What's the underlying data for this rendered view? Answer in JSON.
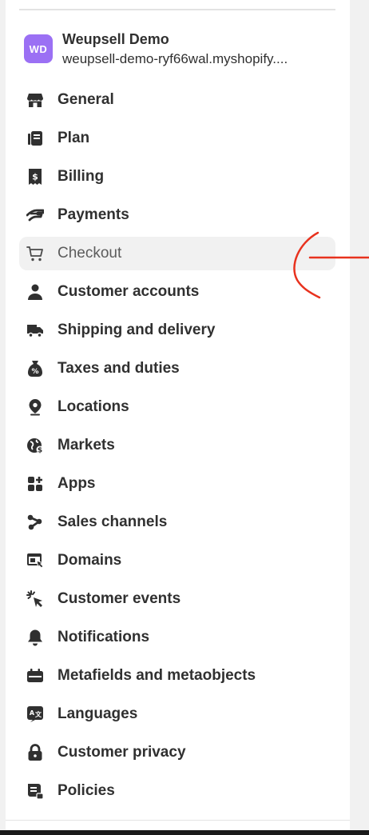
{
  "store": {
    "initials": "WD",
    "name": "Weupsell Demo",
    "domain": "weupsell-demo-ryf66wal.myshopify...."
  },
  "nav": {
    "items": [
      {
        "label": "General",
        "icon": "store-icon"
      },
      {
        "label": "Plan",
        "icon": "plan-icon"
      },
      {
        "label": "Billing",
        "icon": "billing-icon"
      },
      {
        "label": "Payments",
        "icon": "payments-icon"
      },
      {
        "label": "Checkout",
        "icon": "cart-icon",
        "selected": true
      },
      {
        "label": "Customer accounts",
        "icon": "person-icon"
      },
      {
        "label": "Shipping and delivery",
        "icon": "truck-icon"
      },
      {
        "label": "Taxes and duties",
        "icon": "tax-icon"
      },
      {
        "label": "Locations",
        "icon": "location-pin-icon"
      },
      {
        "label": "Markets",
        "icon": "globe-icon"
      },
      {
        "label": "Apps",
        "icon": "apps-icon"
      },
      {
        "label": "Sales channels",
        "icon": "sales-channels-icon"
      },
      {
        "label": "Domains",
        "icon": "domains-icon"
      },
      {
        "label": "Customer events",
        "icon": "cursor-click-icon"
      },
      {
        "label": "Notifications",
        "icon": "bell-icon"
      },
      {
        "label": "Metafields and metaobjects",
        "icon": "metafields-icon"
      },
      {
        "label": "Languages",
        "icon": "languages-icon"
      },
      {
        "label": "Customer privacy",
        "icon": "lock-icon"
      },
      {
        "label": "Policies",
        "icon": "policies-icon"
      }
    ]
  },
  "colors": {
    "avatar": "#9b70f4",
    "text": "#303030",
    "selected_bg": "#f1f1f1",
    "annotation": "#e8321e"
  }
}
